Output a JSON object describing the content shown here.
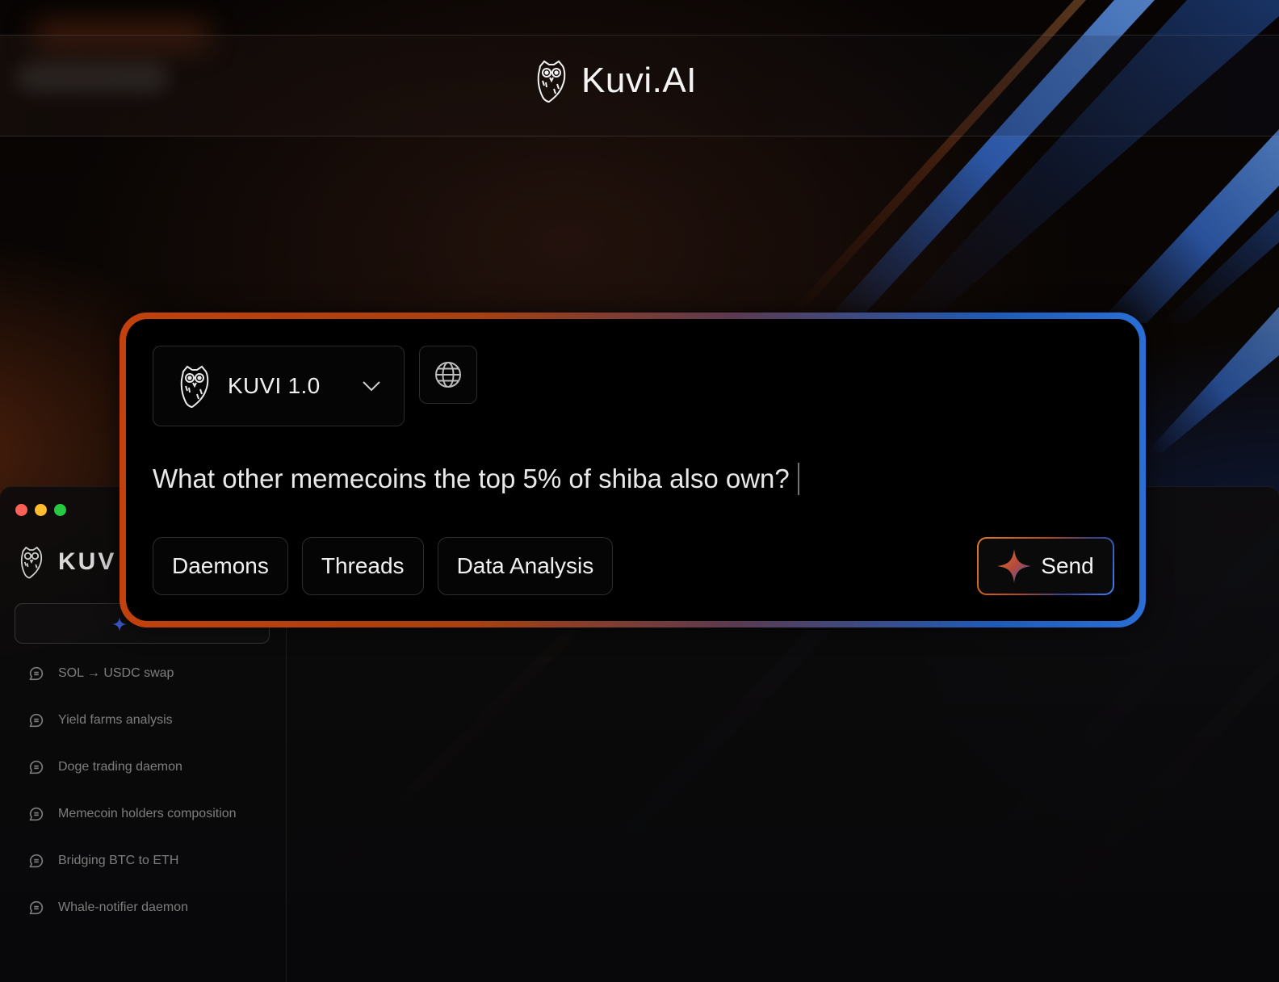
{
  "header": {
    "brand": "Kuvi.AI",
    "logo_icon": "owl-icon"
  },
  "prompt": {
    "model": {
      "label": "KUVI 1.0",
      "icon": "owl-icon",
      "dropdown_icon": "chevron-down-icon"
    },
    "web_search_icon": "globe-icon",
    "query": "What other memecoins the top 5% of shiba also own?",
    "chips": [
      {
        "label": "Daemons"
      },
      {
        "label": "Threads"
      },
      {
        "label": "Data Analysis"
      }
    ],
    "send": {
      "label": "Send",
      "icon": "sparkle-icon"
    }
  },
  "background_app": {
    "logo_text": "KUV",
    "window_controls": [
      "close",
      "minimize",
      "maximize"
    ],
    "threads": [
      {
        "label": "SOL → USDC swap"
      },
      {
        "label": "Yield farms analysis"
      },
      {
        "label": "Doge trading daemon"
      },
      {
        "label": "Memecoin holders composition"
      },
      {
        "label": "Bridging BTC to ETH"
      },
      {
        "label": "Whale-notifier daemon"
      }
    ]
  },
  "colors": {
    "accent_orange": "#c2410c",
    "accent_blue": "#2a6fd6",
    "background": "#000000",
    "traffic_red": "#fe5f57",
    "traffic_yellow": "#febc2e",
    "traffic_green": "#28c840"
  }
}
